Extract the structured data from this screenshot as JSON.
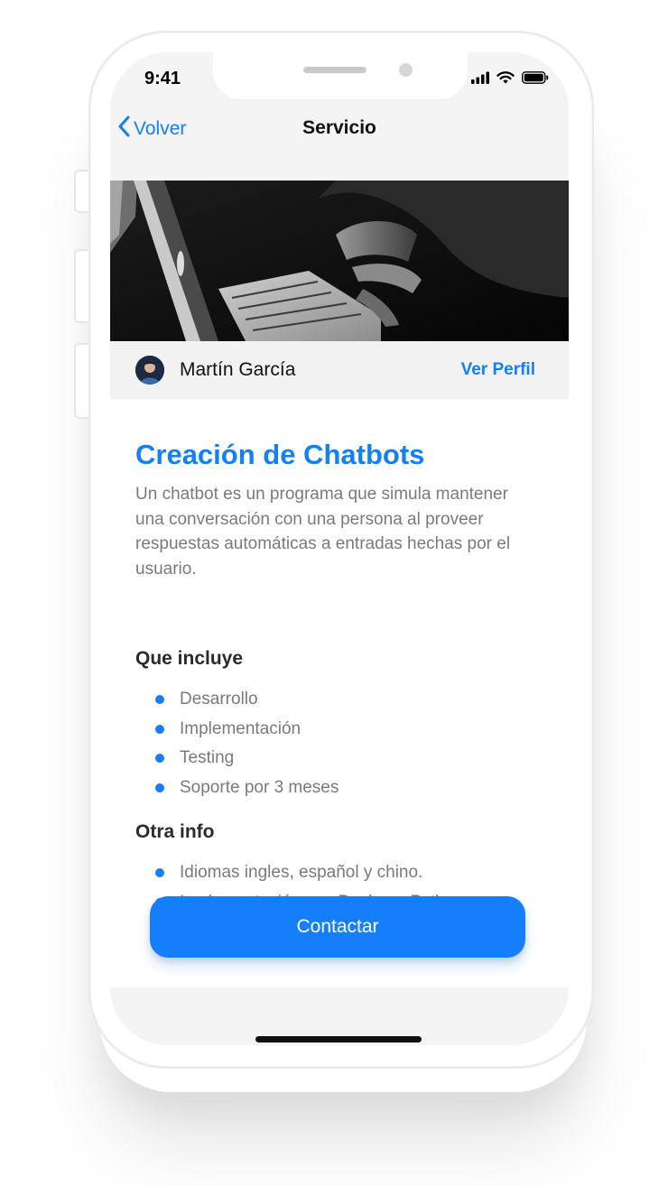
{
  "status_bar": {
    "time": "9:41"
  },
  "nav": {
    "back_label": "Volver",
    "title": "Servicio"
  },
  "hero": {
    "icon": "laptop-photo"
  },
  "author": {
    "name": "Martín García",
    "profile_link": "Ver Perfil"
  },
  "service": {
    "title": "Creación de Chatbots",
    "description": "Un chatbot es un programa que simula mantener una conversación con una persona al proveer respuestas automáticas a entradas hechas por el usuario."
  },
  "includes": {
    "title": "Que incluye",
    "items": [
      "Desarrollo",
      "Implementación",
      "Testing",
      "Soporte por 3 meses"
    ]
  },
  "other_info": {
    "title": "Otra info",
    "items": [
      "Idiomas ingles, español y chino.",
      "Implementación con Docker y Python."
    ]
  },
  "contact_button": {
    "label": "Contactar"
  },
  "colors": {
    "accent": "#147efb",
    "title_blue": "#1380f6",
    "text_gray": "#7a7a7a"
  }
}
